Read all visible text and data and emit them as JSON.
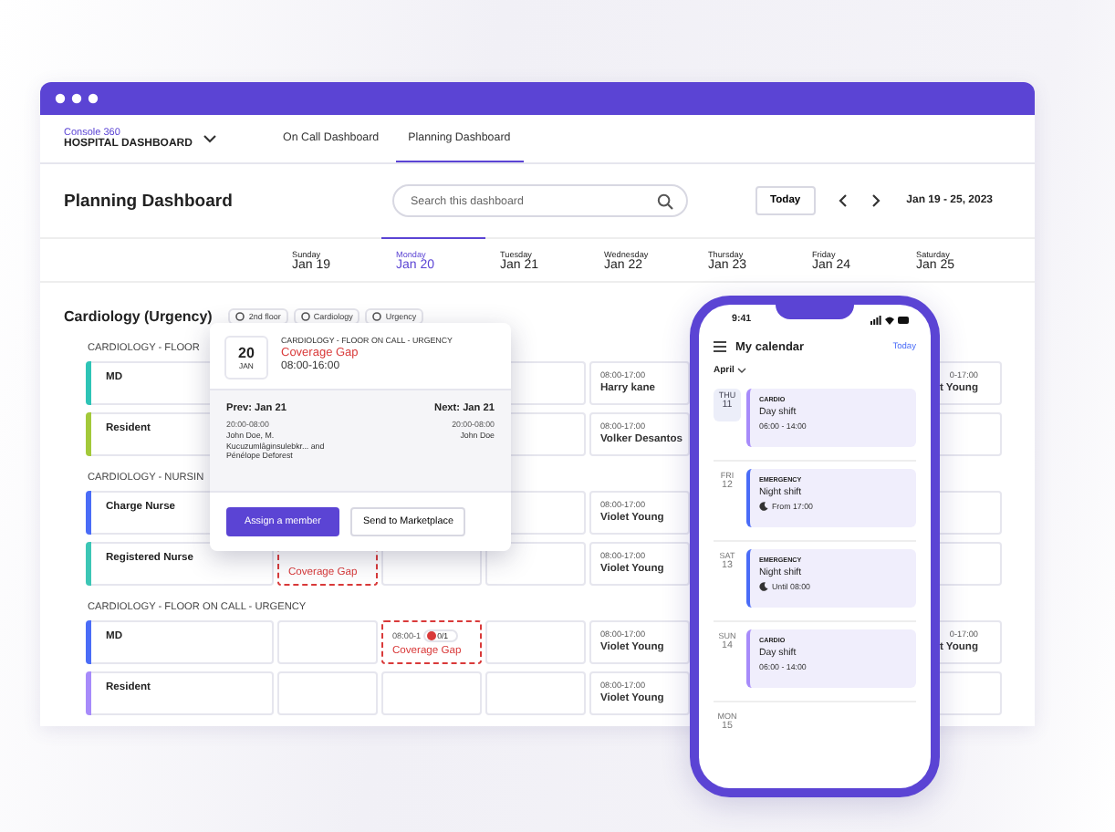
{
  "brand": {
    "product": "Console 360",
    "title": "HOSPITAL DASHBOARD"
  },
  "tabs": [
    {
      "label": "On Call Dashboard",
      "selected": false
    },
    {
      "label": "Planning Dashboard",
      "selected": true
    }
  ],
  "header": {
    "title": "Planning Dashboard",
    "search": {
      "placeholder": "Search this dashboard"
    },
    "today_button": "Today",
    "date_range": "Jan 19 - 25, 2023"
  },
  "days": [
    {
      "weekday": "Sunday",
      "date": "Jan 19",
      "selected": false
    },
    {
      "weekday": "Monday",
      "date": "Jan 20",
      "selected": true
    },
    {
      "weekday": "Tuesday",
      "date": "Jan 21",
      "selected": false
    },
    {
      "weekday": "Wednesday",
      "date": "Jan 22",
      "selected": false
    },
    {
      "weekday": "Thursday",
      "date": "Jan 23",
      "selected": false
    },
    {
      "weekday": "Friday",
      "date": "Jan 24",
      "selected": false
    },
    {
      "weekday": "Saturday",
      "date": "Jan 25",
      "selected": false
    }
  ],
  "section": {
    "title": "Cardiology (Urgency)",
    "chips": [
      "2nd floor",
      "Cardiology",
      "Urgency"
    ]
  },
  "groups": [
    {
      "title": "CARDIOLOGY - FLOOR",
      "rows": [
        {
          "role": "MD",
          "color": "#2ec4b6",
          "cells": [
            {
              "kind": "covered"
            },
            {
              "kind": "covered"
            },
            {
              "kind": "empty"
            },
            {
              "kind": "shift",
              "time": "08:00-17:00",
              "name": "Harry kane"
            },
            {
              "kind": "covered"
            },
            {
              "kind": "covered"
            },
            {
              "kind": "partial",
              "time": "0-17:00",
              "name": "t Young"
            }
          ]
        },
        {
          "role": "Resident",
          "color": "#a3c93a",
          "cells": [
            {
              "kind": "covered"
            },
            {
              "kind": "covered"
            },
            {
              "kind": "empty"
            },
            {
              "kind": "shift",
              "time": "08:00-17:00",
              "name": "Volker Desantos"
            },
            {
              "kind": "covered"
            },
            {
              "kind": "covered"
            },
            {
              "kind": "empty"
            }
          ]
        }
      ]
    },
    {
      "title": "CARDIOLOGY - NURSIN",
      "rows": [
        {
          "role": "Charge Nurse",
          "color": "#4a6cf7",
          "cells": [
            {
              "kind": "covered"
            },
            {
              "kind": "covered"
            },
            {
              "kind": "empty"
            },
            {
              "kind": "shift",
              "time": "08:00-17:00",
              "name": "Violet Young"
            },
            {
              "kind": "covered"
            },
            {
              "kind": "covered"
            },
            {
              "kind": "empty"
            }
          ]
        },
        {
          "role": "Registered Nurse",
          "color": "#3cc6b5",
          "cells": [
            {
              "kind": "gap",
              "label": "Coverage Gap"
            },
            {
              "kind": "empty"
            },
            {
              "kind": "empty"
            },
            {
              "kind": "shift",
              "time": "08:00-17:00",
              "name": "Violet Young"
            },
            {
              "kind": "covered"
            },
            {
              "kind": "covered"
            },
            {
              "kind": "empty"
            }
          ]
        }
      ]
    },
    {
      "title": "CARDIOLOGY - FLOOR ON CALL - URGENCY",
      "rows": [
        {
          "role": "MD",
          "color": "#4a6cf7",
          "cells": [
            {
              "kind": "empty"
            },
            {
              "kind": "gap",
              "time": "08:00-1",
              "count": "0/1",
              "label": "Coverage Gap"
            },
            {
              "kind": "empty"
            },
            {
              "kind": "shift",
              "time": "08:00-17:00",
              "name": "Violet Young"
            },
            {
              "kind": "covered"
            },
            {
              "kind": "covered"
            },
            {
              "kind": "partial",
              "time": "0-17:00",
              "name": "t Young"
            }
          ]
        },
        {
          "role": "Resident",
          "color": "#a78bfa",
          "cells": [
            {
              "kind": "empty"
            },
            {
              "kind": "empty"
            },
            {
              "kind": "empty"
            },
            {
              "kind": "shift",
              "time": "08:00-17:00",
              "name": "Violet Young"
            },
            {
              "kind": "covered"
            },
            {
              "kind": "covered"
            },
            {
              "kind": "empty"
            }
          ]
        }
      ]
    }
  ],
  "popup": {
    "day": "20",
    "month": "JAN",
    "unit": "CARDIOLOGY - FLOOR ON CALL - URGENCY",
    "status": "Coverage Gap",
    "time": "08:00-16:00",
    "prev": {
      "label": "Prev: Jan 21",
      "time": "20:00-08:00",
      "staff": "John Doe, M. Kucuzumlâginsulebkr... and Pénélope Deforest"
    },
    "next": {
      "label": "Next: Jan 21",
      "time": "20:00-08:00",
      "staff": "John Doe"
    },
    "buttons": [
      {
        "label": "Assign a member",
        "kind": "primary"
      },
      {
        "label": "Send to Marketplace",
        "kind": "secondary"
      }
    ]
  },
  "phone": {
    "time": "9:41",
    "title": "My calendar",
    "today_link": "Today",
    "month": "April",
    "days": [
      {
        "weekday": "THU",
        "day": "11",
        "selected": true,
        "event": {
          "category": "CARDIO",
          "title": "Day shift",
          "time": "06:00 - 14:00",
          "night": false,
          "color": "#a78bfa"
        }
      },
      {
        "weekday": "FRI",
        "day": "12",
        "selected": false,
        "event": {
          "category": "EMERGENCY",
          "title": "Night shift",
          "time": "From 17:00",
          "night": true,
          "color": "#4a6cf7"
        }
      },
      {
        "weekday": "SAT",
        "day": "13",
        "selected": false,
        "event": {
          "category": "EMERGENCY",
          "title": "Night shift",
          "time": "Until 08:00",
          "night": true,
          "color": "#4a6cf7"
        }
      },
      {
        "weekday": "SUN",
        "day": "14",
        "selected": false,
        "event": {
          "category": "CARDIO",
          "title": "Day shift",
          "time": "06:00 - 14:00",
          "night": false,
          "color": "#a78bfa"
        }
      },
      {
        "weekday": "MON",
        "day": "15",
        "selected": false
      }
    ]
  }
}
